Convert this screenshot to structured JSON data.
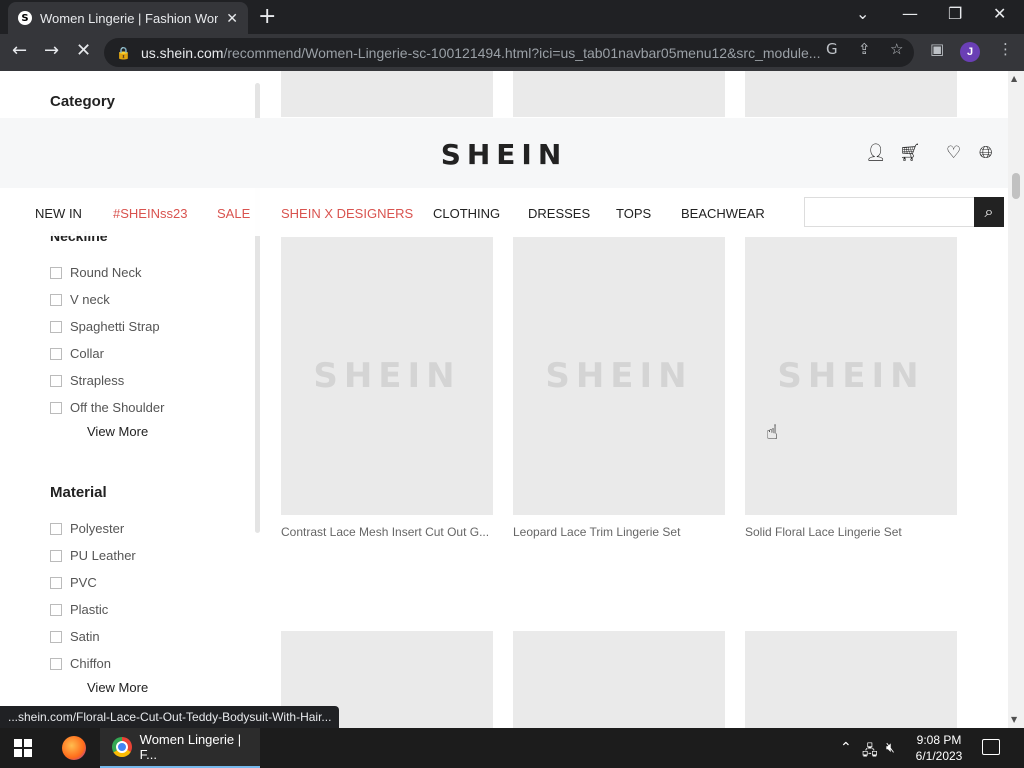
{
  "browser": {
    "tab_favicon": "S",
    "tab_title": "Women Lingerie | Fashion Wome",
    "url_host": "us.shein.com",
    "url_path": "/recommend/Women-Lingerie-sc-100121494.html?ici=us_tab01navbar05menu12&src_module...",
    "profile_initial": "J",
    "status_url": "...shein.com/Floral-Lace-Cut-Out-Teddy-Bodysuit-With-Hair..."
  },
  "header": {
    "logo": "SHEIN",
    "nav": [
      "NEW IN",
      "#SHEINss23",
      "SALE",
      "SHEIN X DESIGNERS",
      "CLOTHING",
      "DRESSES",
      "TOPS",
      "BEACHWEAR"
    ],
    "search_placeholder": ""
  },
  "sidebar": {
    "category_title": "Category",
    "neckline_title": "Neckline",
    "neckline_items": [
      "Round Neck",
      "V neck",
      "Spaghetti Strap",
      "Collar",
      "Strapless",
      "Off the Shoulder"
    ],
    "neckline_view_more": "View More",
    "material_title": "Material",
    "material_items": [
      "Polyester",
      "PU Leather",
      "PVC",
      "Plastic",
      "Satin",
      "Chiffon"
    ],
    "material_view_more": "View More"
  },
  "products": {
    "placeholder_logo": "SHEIN",
    "row1": [
      "Contrast Lace Mesh Insert Cut Out G...",
      "Leopard Lace Trim Lingerie Set",
      "Solid Floral Lace Lingerie Set"
    ]
  },
  "taskbar": {
    "chrome_label": "Women Lingerie | F...",
    "time": "9:08 PM",
    "date": "6/1/2023"
  },
  "colors": {
    "accent_red": "#d9534f",
    "chrome_dark": "#202124",
    "placeholder_gray": "#eaeaea"
  }
}
